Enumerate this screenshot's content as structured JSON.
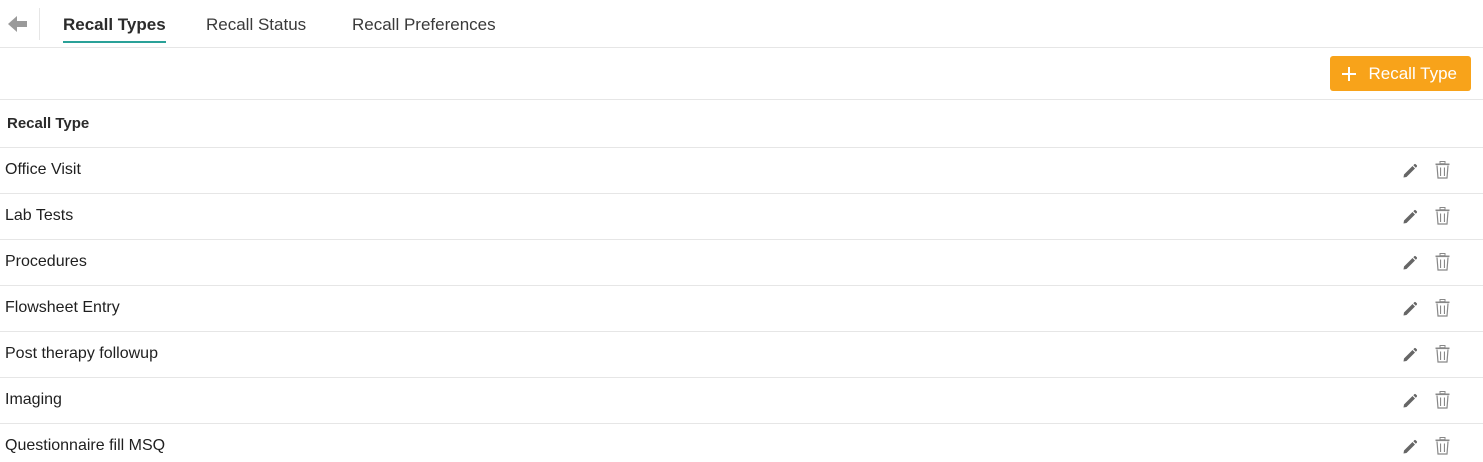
{
  "tabs": [
    {
      "label": "Recall Types",
      "active": true
    },
    {
      "label": "Recall Status",
      "active": false
    },
    {
      "label": "Recall Preferences",
      "active": false
    }
  ],
  "toolbar": {
    "add_button_label": "Recall Type",
    "accent_color": "#f8a31a"
  },
  "table": {
    "header": "Recall Type",
    "rows": [
      "Office Visit",
      "Lab Tests",
      "Procedures",
      "Flowsheet Entry",
      "Post therapy followup",
      "Imaging",
      "Questionnaire fill MSQ"
    ],
    "row_actions": [
      "pencil-icon",
      "trash-icon"
    ]
  },
  "colors": {
    "active_tab_underline": "#2aa198",
    "icon_gray": "#666666",
    "border": "#e6e6e6"
  }
}
